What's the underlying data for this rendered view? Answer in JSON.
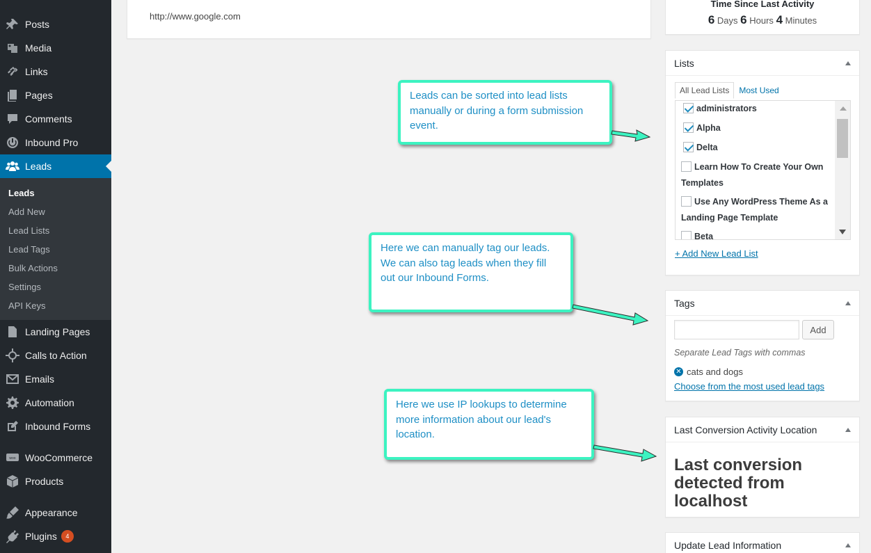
{
  "sidebar": {
    "items": [
      {
        "label": "Posts",
        "icon": "pin-icon"
      },
      {
        "label": "Media",
        "icon": "media-icon"
      },
      {
        "label": "Links",
        "icon": "link-icon"
      },
      {
        "label": "Pages",
        "icon": "pages-icon"
      },
      {
        "label": "Comments",
        "icon": "comments-icon"
      },
      {
        "label": "Inbound Pro",
        "icon": "power-icon"
      },
      {
        "label": "Leads",
        "icon": "users-icon"
      },
      {
        "label": "Landing Pages",
        "icon": "document-icon"
      },
      {
        "label": "Calls to Action",
        "icon": "crosshair-icon"
      },
      {
        "label": "Emails",
        "icon": "email-icon"
      },
      {
        "label": "Automation",
        "icon": "gear-icon"
      },
      {
        "label": "Inbound Forms",
        "icon": "edit-icon"
      },
      {
        "label": "WooCommerce",
        "icon": "woo-icon"
      },
      {
        "label": "Products",
        "icon": "box-icon"
      },
      {
        "label": "Appearance",
        "icon": "brush-icon"
      },
      {
        "label": "Plugins",
        "icon": "plug-icon",
        "badge": "4"
      }
    ],
    "submenu": [
      "Leads",
      "Add New",
      "Lead Lists",
      "Lead Tags",
      "Bulk Actions",
      "Settings",
      "API Keys"
    ]
  },
  "main": {
    "url": "http://www.google.com"
  },
  "callouts": {
    "lists": "Leads can be sorted into lead lists manually or during a form submission event.",
    "tags": "Here we can manually tag our leads. We can also tag leads when they fill out our Inbound Forms.",
    "location": "Here we use IP lookups to determine more information about our lead's location."
  },
  "activity": {
    "title": "Time Since Last Activity",
    "days": "6",
    "days_label": "Days",
    "hours": "6",
    "hours_label": "Hours",
    "minutes": "4",
    "minutes_label": "Minutes"
  },
  "lists": {
    "title": "Lists",
    "tab_all": "All Lead Lists",
    "tab_most": "Most Used",
    "items": [
      {
        "label": "administrators",
        "checked": true
      },
      {
        "label": "Alpha",
        "checked": true
      },
      {
        "label": "Delta",
        "checked": true
      },
      {
        "label": "Learn How To Create Your Own Templates",
        "checked": false
      },
      {
        "label": "Use Any WordPress Theme As a Landing Page Template",
        "checked": false
      },
      {
        "label": "Beta",
        "checked": false
      }
    ],
    "add_link": "+ Add New Lead List"
  },
  "tags": {
    "title": "Tags",
    "input_value": "",
    "add_label": "Add",
    "hint": "Separate Lead Tags with commas",
    "tag": "cats and dogs",
    "choose_link": "Choose from the most used lead tags"
  },
  "location": {
    "title": "Last Conversion Activity Location",
    "text": "Last conversion detected from localhost"
  },
  "update": {
    "title": "Update Lead Information"
  },
  "colors": {
    "callout_border": "#3cf3c1",
    "callout_text": "#1e8fc5",
    "sidebar_bg": "#23282d",
    "active": "#0073aa"
  }
}
